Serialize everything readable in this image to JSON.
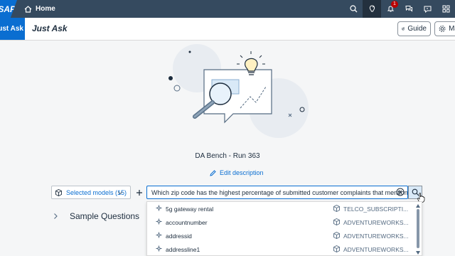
{
  "shell": {
    "logo_text": "SAP",
    "home_label": "Home",
    "notification_count": "1"
  },
  "header": {
    "app_tab_label": "Just Ask",
    "title": "Just Ask",
    "guide_label": "Guide",
    "manage_label": "Ma"
  },
  "main": {
    "run_title": "DA Bench - Run 363",
    "edit_description": "Edit description",
    "models_select_label": "Selected models (15)",
    "query_value": "Which zip code has the highest percentage of submitted customer complaints that mention Comca",
    "sample_questions_label": "Sample Questions"
  },
  "suggestions": [
    {
      "column": "5g gateway rental",
      "table": "TELCO_SUBSCRIPTI..."
    },
    {
      "column": "accountnumber",
      "table": "ADVENTUREWORKS..."
    },
    {
      "column": "addressid",
      "table": "ADVENTUREWORKS..."
    },
    {
      "column": "addressline1",
      "table": "ADVENTUREWORKS..."
    }
  ],
  "colors": {
    "shell_bg": "#354a5f",
    "accent": "#0a6ed1",
    "badge": "#bb0000"
  }
}
